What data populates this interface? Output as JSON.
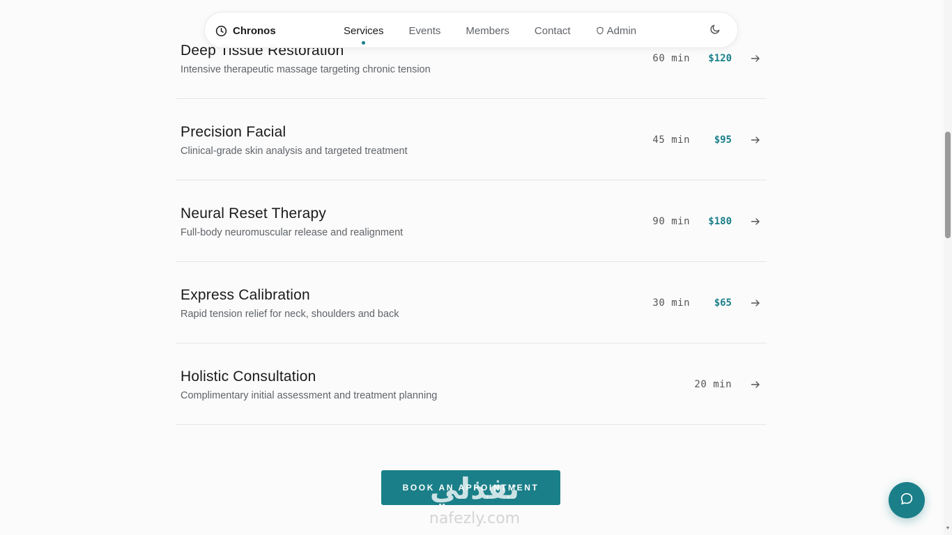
{
  "nav": {
    "brand": "Chronos",
    "links": [
      "Services",
      "Events",
      "Members",
      "Contact",
      "Admin"
    ],
    "active": "Services",
    "icons": {
      "brand": "clock-icon",
      "admin": "shield-icon",
      "theme": "moon-icon"
    }
  },
  "services": [
    {
      "title": "Deep Tissue Restoration",
      "description": "Intensive therapeutic massage targeting chronic tension",
      "duration": "60 min",
      "price": "$120"
    },
    {
      "title": "Precision Facial",
      "description": "Clinical-grade skin analysis and targeted treatment",
      "duration": "45 min",
      "price": "$95"
    },
    {
      "title": "Neural Reset Therapy",
      "description": "Full-body neuromuscular release and realignment",
      "duration": "90 min",
      "price": "$180"
    },
    {
      "title": "Express Calibration",
      "description": "Rapid tension relief for neck, shoulders and back",
      "duration": "30 min",
      "price": "$65"
    },
    {
      "title": "Holistic Consultation",
      "description": "Complimentary initial assessment and treatment planning",
      "duration": "20 min",
      "price": ""
    }
  ],
  "cta": {
    "label": "BOOK AN APPOINTMENT"
  },
  "watermark": {
    "arabic": "نفذلي",
    "latin": "nafezly.com"
  },
  "colors": {
    "accent": "#1a7f88",
    "background": "#fbfbfb",
    "text": "#1a1a1a",
    "muted": "#5f6368"
  }
}
